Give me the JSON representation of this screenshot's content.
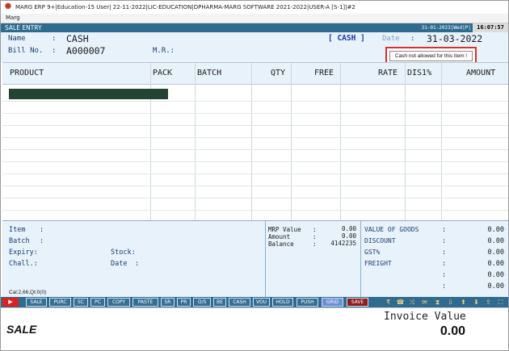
{
  "window": {
    "title": "MARG ERP 9+|Education-15 User| 22-11-2022|LIC-EDUCATION|DPHARMA-MARG SOFTWARE 2021-2022|USER-A [S-1]|#2"
  },
  "menubar": {
    "label": "Marg"
  },
  "entry_bar": {
    "title": "SALE ENTRY",
    "date": "31-01-2023|Wed|P|",
    "time": "16:07:57"
  },
  "header": {
    "name_label": "Name",
    "name_colon": ":",
    "name_value": "CASH",
    "bill_label": "Bill No.",
    "bill_colon": ":",
    "bill_value": "A000007",
    "mr_label": "M.R.:",
    "mode": "[ CASH ]",
    "date_label": "Date",
    "date_colon": ":",
    "date_value": "31-03-2022"
  },
  "tooltip": {
    "text": "Cash not allowed for this Item !"
  },
  "grid": {
    "columns": [
      "PRODUCT",
      "PACK",
      "BATCH",
      "QTY",
      "FREE",
      "RATE",
      "DIS1%",
      "AMOUNT"
    ]
  },
  "item_info": {
    "item_label": "Item",
    "batch_label": "Batch",
    "expiry_label": "Expiry:",
    "chall_label": "Chall.:",
    "stock_label": "Stock:",
    "date_label": "Date",
    "colon": ":",
    "cal": "Cal:2,66,Qt:0(0)"
  },
  "mrp_panel": {
    "mrp_label": "MRP Value",
    "mrp_value": "0.00",
    "amount_label": "Amount",
    "amount_value": "0.00",
    "balance_label": "Balance",
    "balance_value": "4142235",
    "colon": ":"
  },
  "totals": {
    "goods_label": "VALUE OF GOODS",
    "goods_value": "0.00",
    "discount_label": "DISCOUNT",
    "discount_value": "0.00",
    "gst_label": "GST%",
    "gst_value": "0.00",
    "freight_label": "FREIGHT",
    "freight_value": "0.00",
    "extra1_value": "0.00",
    "extra2_value": "0.00",
    "colon": ":"
  },
  "toolbar": {
    "buttons": [
      "SALE",
      "PURC",
      "SC",
      "PC",
      "COPY",
      "PASTE",
      "SR",
      "PR",
      "O/S",
      "BE",
      "CASH",
      "VOU",
      "HOLD",
      "PUSH",
      "GRID",
      "SAVE"
    ],
    "icons": [
      "rupee-icon",
      "phone-icon",
      "shuffle-icon",
      "sms-icon",
      "hourglass-icon",
      "download-icon",
      "up-arrow-icon",
      "down-arrow-icon",
      "upload-icon",
      "fullscreen-icon"
    ]
  },
  "footer": {
    "mode_label": "SALE",
    "invoice_label": "Invoice Value",
    "invoice_value": "0.00"
  }
}
